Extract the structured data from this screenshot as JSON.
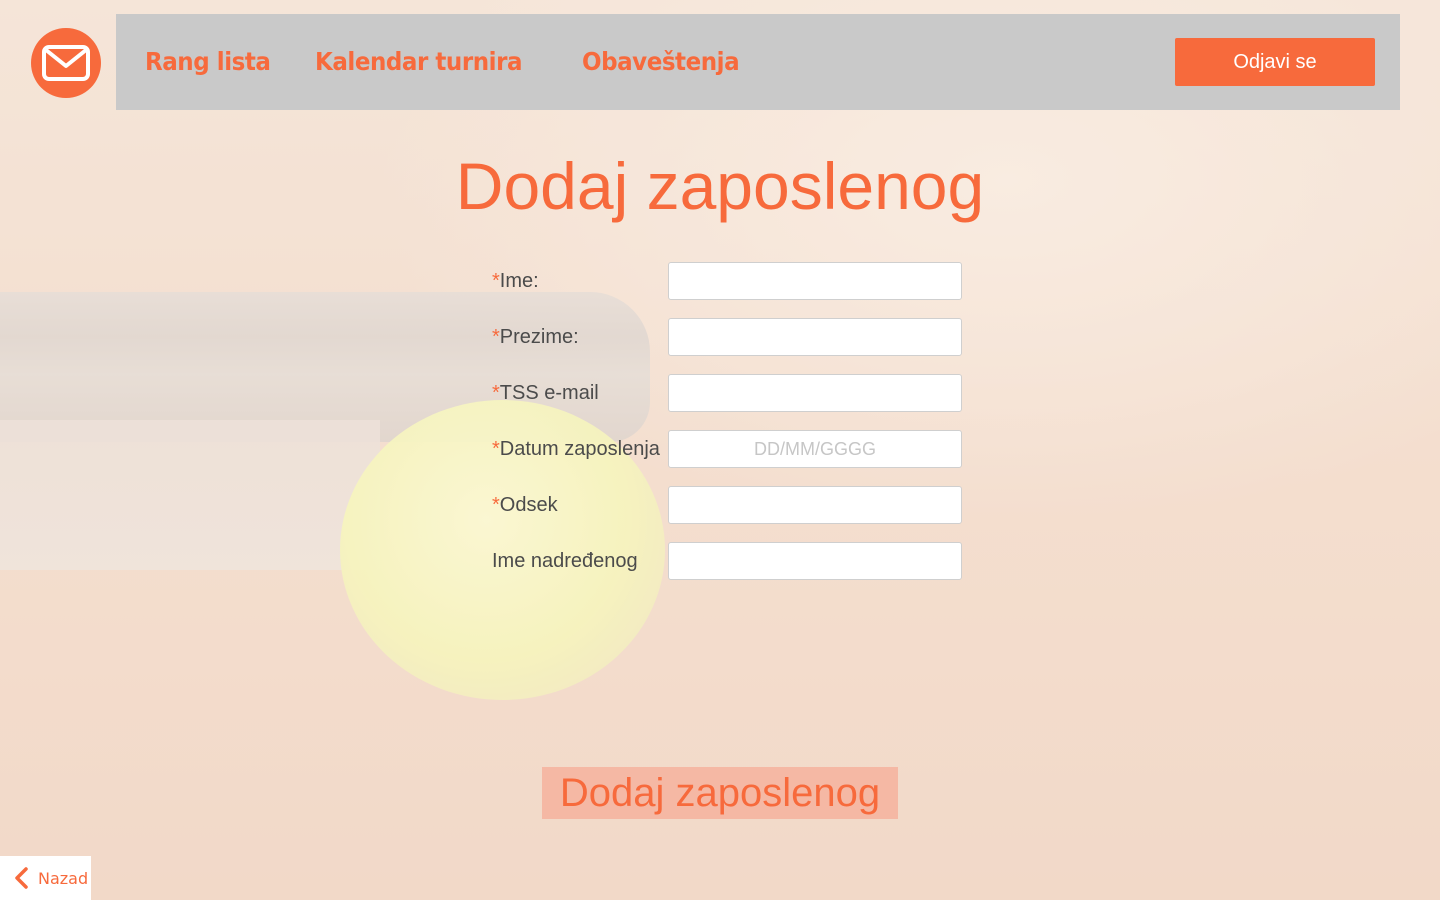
{
  "header": {
    "logo_icon": "envelope-icon",
    "nav": [
      {
        "label": "Rang lista"
      },
      {
        "label": "Kalendar turnira"
      },
      {
        "label": "Obaveštenja"
      }
    ],
    "logout_label": "Odjavi se"
  },
  "page": {
    "title": "Dodaj zaposlenog"
  },
  "form": {
    "required_mark": "*",
    "fields": [
      {
        "label": "Ime:",
        "required": true,
        "value": "",
        "placeholder": ""
      },
      {
        "label": "Prezime:",
        "required": true,
        "value": "",
        "placeholder": ""
      },
      {
        "label": "TSS e-mail",
        "required": true,
        "value": "",
        "placeholder": ""
      },
      {
        "label": "Datum zaposlenja",
        "required": true,
        "value": "",
        "placeholder": "DD/MM/GGGG"
      },
      {
        "label": "Odsek",
        "required": true,
        "value": "",
        "placeholder": ""
      },
      {
        "label": "Ime nadređenog",
        "required": false,
        "value": "",
        "placeholder": ""
      }
    ],
    "submit_label": "Dodaj zaposlenog"
  },
  "back": {
    "label": "Nazad",
    "icon": "chevron-left-icon"
  },
  "colors": {
    "accent": "#f76a3c",
    "topbar": "#c9c9c9",
    "submit_bg": "#f5b8a4"
  }
}
